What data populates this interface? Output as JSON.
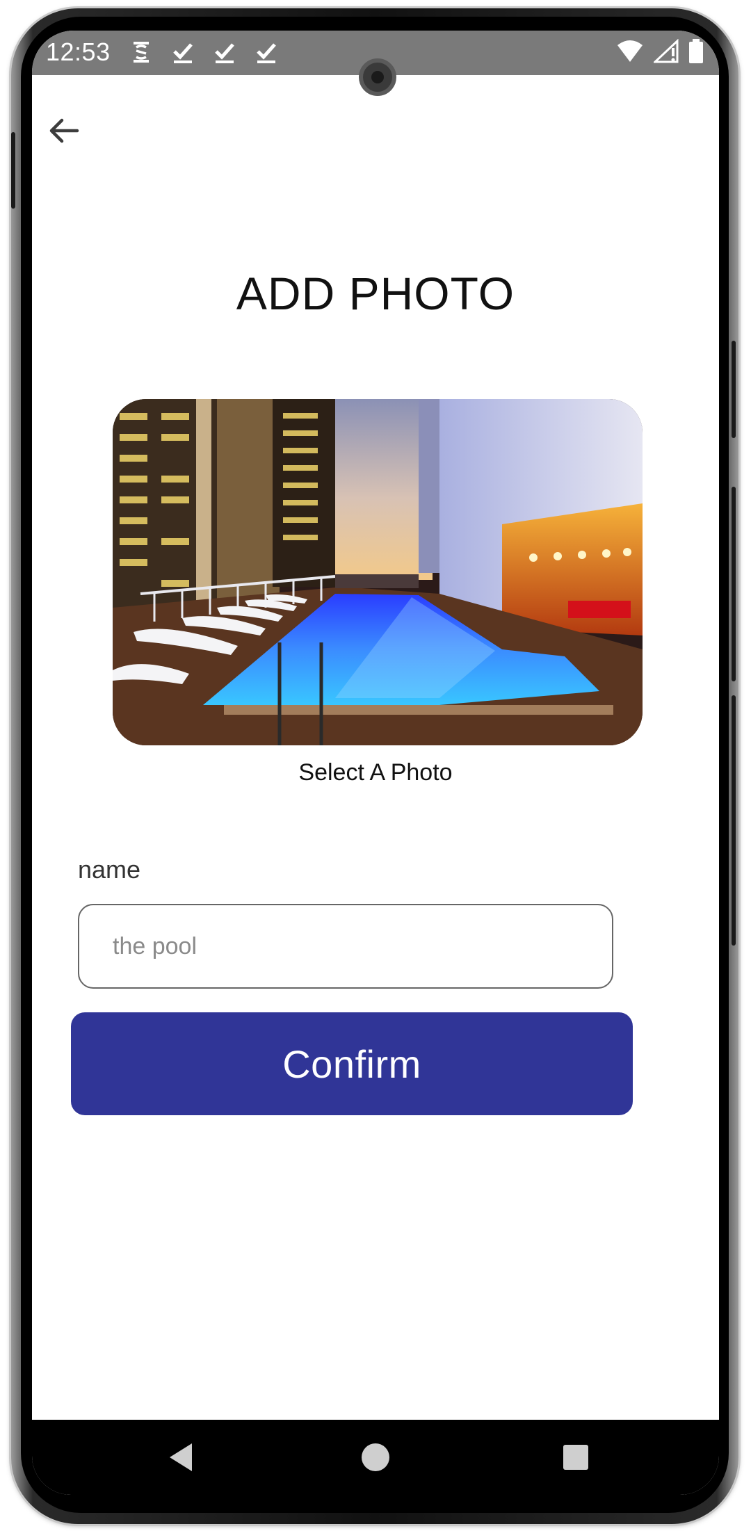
{
  "status_bar": {
    "time": "12:53",
    "left_icons": [
      "sync-icon",
      "check-icon",
      "check-icon",
      "check-icon"
    ],
    "right_icons": [
      "wifi-icon",
      "signal-icon",
      "battery-icon"
    ],
    "background": "#7a7a7a"
  },
  "header": {
    "back_icon": "arrow-left-icon",
    "title": "ADD PHOTO"
  },
  "photo": {
    "caption": "Select A Photo"
  },
  "form": {
    "name_label": "name",
    "name_placeholder": "the pool",
    "name_value": ""
  },
  "actions": {
    "confirm_label": "Confirm",
    "confirm_color": "#303597"
  },
  "nav_bar": {
    "buttons": [
      "nav-back-icon",
      "nav-home-icon",
      "nav-recents-icon"
    ]
  }
}
